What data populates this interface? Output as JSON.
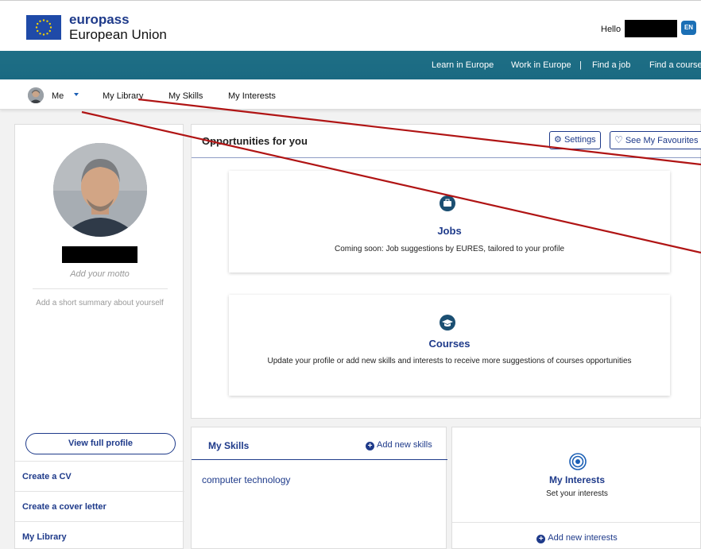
{
  "header": {
    "brand": "europass",
    "org": "European Union",
    "greeting": "Hello",
    "lang": "EN",
    "flag_color": "#1f4aa8"
  },
  "top_nav": {
    "items": [
      "Learn in Europe",
      "Work in Europe",
      "|",
      "Find a job",
      "Find a course"
    ],
    "bg_color": "#1f6f86"
  },
  "sub_nav": {
    "items": [
      "Me",
      "My Library",
      "My Skills",
      "My Interests"
    ]
  },
  "profile": {
    "motto_placeholder": "Add your motto",
    "summary_placeholder": "Add a short summary about yourself",
    "view_profile": "View full profile",
    "links": [
      "Create a CV",
      "Create a cover letter",
      "My Library"
    ]
  },
  "opportunities": {
    "title": "Opportunities for you",
    "settings_label": "Settings",
    "favourites_label": "See My Favourites",
    "cards": [
      {
        "icon": "briefcase-icon",
        "title": "Jobs",
        "description": "Coming soon: Job suggestions by EURES, tailored to your profile"
      },
      {
        "icon": "graduation-cap-icon",
        "title": "Courses",
        "description": "Update your profile or add new skills and interests to receive more suggestions of courses opportunities"
      }
    ]
  },
  "skills": {
    "title": "My Skills",
    "add_label": "Add new skills",
    "items": [
      "computer technology"
    ]
  },
  "interests": {
    "title": "My Interests",
    "subtitle": "Set your interests",
    "add_label": "Add new interests"
  },
  "annotation": {
    "arrow_color": "#b01414"
  }
}
